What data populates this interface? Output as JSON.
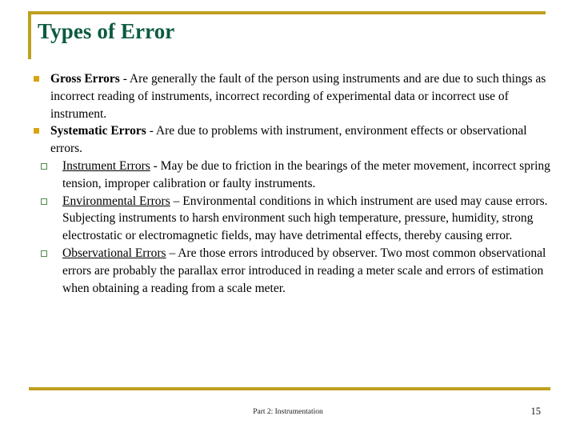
{
  "slide": {
    "title": "Types of Error",
    "accent_gold": "#bfa01e",
    "title_green": "#0c5a41",
    "bullet_l1_color": "#d9a412",
    "bullet_l2_color": "#4f8a4a",
    "background": "#ffffff"
  },
  "content": {
    "bullets": [
      {
        "lead": "Gross Errors",
        "lead_style": "bold",
        "text": "  - Are generally the fault of the person using instruments and are due to such things as incorrect reading of instruments, incorrect recording of experimental data or incorrect use of instrument."
      },
      {
        "lead": "Systematic Errors",
        "lead_style": "bold",
        "text": " - Are due to problems with instrument, environment effects or observational errors."
      }
    ],
    "subbullets": [
      {
        "lead": "Instrument Errors",
        "lead_style": "underline",
        "text": " - May be due to friction in the bearings of the meter movement, incorrect spring tension, improper calibration or faulty instruments."
      },
      {
        "lead": "Environmental Errors",
        "lead_style": "underline",
        "text": " – Environmental conditions in which instrument are used may cause errors. Subjecting instruments to harsh environment such high temperature, pressure, humidity, strong electrostatic or electromagnetic fields, may have detrimental effects, thereby causing error."
      },
      {
        "lead": "Observational Errors",
        "lead_style": "underline",
        "text": " – Are those errors introduced by observer. Two most common observational errors are probably the parallax error introduced in reading a meter scale and errors of estimation when obtaining a reading from a scale meter."
      }
    ]
  },
  "footer": {
    "center_text": "Part 2: Instrumentation",
    "page_number": "15"
  }
}
